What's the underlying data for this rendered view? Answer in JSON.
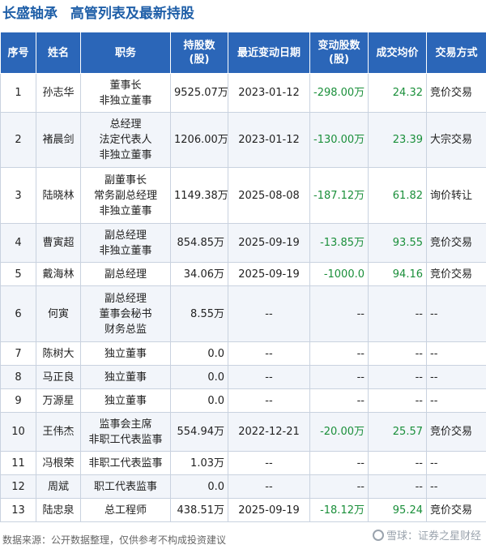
{
  "header": {
    "company": "长盛轴承",
    "subtitle": "高管列表及最新持股"
  },
  "table": {
    "columns": [
      "序号",
      "姓名",
      "职务",
      "持股数\n(股)",
      "最近变动日期",
      "变动股数\n(股)",
      "成交均价",
      "交易方式"
    ],
    "rows": [
      {
        "no": "1",
        "name": "孙志华",
        "roles": [
          "董事长",
          "非独立董事"
        ],
        "shares": "9525.07万",
        "date": "2023-01-12",
        "change": "-298.00万",
        "price": "24.32",
        "method": "竞价交易"
      },
      {
        "no": "2",
        "name": "褚晨剑",
        "roles": [
          "总经理",
          "法定代表人",
          "非独立董事"
        ],
        "shares": "1206.00万",
        "date": "2023-01-12",
        "change": "-130.00万",
        "price": "23.39",
        "method": "大宗交易"
      },
      {
        "no": "3",
        "name": "陆晓林",
        "roles": [
          "副董事长",
          "常务副总经理",
          "非独立董事"
        ],
        "shares": "1149.38万",
        "date": "2025-08-08",
        "change": "-187.12万",
        "price": "61.82",
        "method": "询价转让"
      },
      {
        "no": "4",
        "name": "曹寅超",
        "roles": [
          "副总经理",
          "非独立董事"
        ],
        "shares": "854.85万",
        "date": "2025-09-19",
        "change": "-13.85万",
        "price": "93.55",
        "method": "竞价交易"
      },
      {
        "no": "5",
        "name": "戴海林",
        "roles": [
          "副总经理"
        ],
        "shares": "34.06万",
        "date": "2025-09-19",
        "change": "-1000.0",
        "price": "94.16",
        "method": "竞价交易"
      },
      {
        "no": "6",
        "name": "何寅",
        "roles": [
          "副总经理",
          "董事会秘书",
          "财务总监"
        ],
        "shares": "8.55万",
        "date": "--",
        "change": "--",
        "price": "--",
        "method": "--"
      },
      {
        "no": "7",
        "name": "陈树大",
        "roles": [
          "独立董事"
        ],
        "shares": "0.0",
        "date": "--",
        "change": "--",
        "price": "--",
        "method": "--"
      },
      {
        "no": "8",
        "name": "马正良",
        "roles": [
          "独立董事"
        ],
        "shares": "0.0",
        "date": "--",
        "change": "--",
        "price": "--",
        "method": "--"
      },
      {
        "no": "9",
        "name": "万源星",
        "roles": [
          "独立董事"
        ],
        "shares": "0.0",
        "date": "--",
        "change": "--",
        "price": "--",
        "method": "--"
      },
      {
        "no": "10",
        "name": "王伟杰",
        "roles": [
          "监事会主席",
          "非职工代表监事"
        ],
        "shares": "554.94万",
        "date": "2022-12-21",
        "change": "-20.00万",
        "price": "25.57",
        "method": "竞价交易"
      },
      {
        "no": "11",
        "name": "冯根荣",
        "roles": [
          "非职工代表监事"
        ],
        "shares": "1.03万",
        "date": "--",
        "change": "--",
        "price": "--",
        "method": "--"
      },
      {
        "no": "12",
        "name": "周斌",
        "roles": [
          "职工代表监事"
        ],
        "shares": "0.0",
        "date": "--",
        "change": "--",
        "price": "--",
        "method": "--"
      },
      {
        "no": "13",
        "name": "陆忠泉",
        "roles": [
          "总工程师"
        ],
        "shares": "438.51万",
        "date": "2025-09-19",
        "change": "-18.12万",
        "price": "95.24",
        "method": "竞价交易"
      }
    ]
  },
  "footer": {
    "source": "数据来源：公开数据整理，仅供参考不构成投资建议",
    "brand": "雪球：证券之星财经"
  },
  "watermark": "证券之星"
}
